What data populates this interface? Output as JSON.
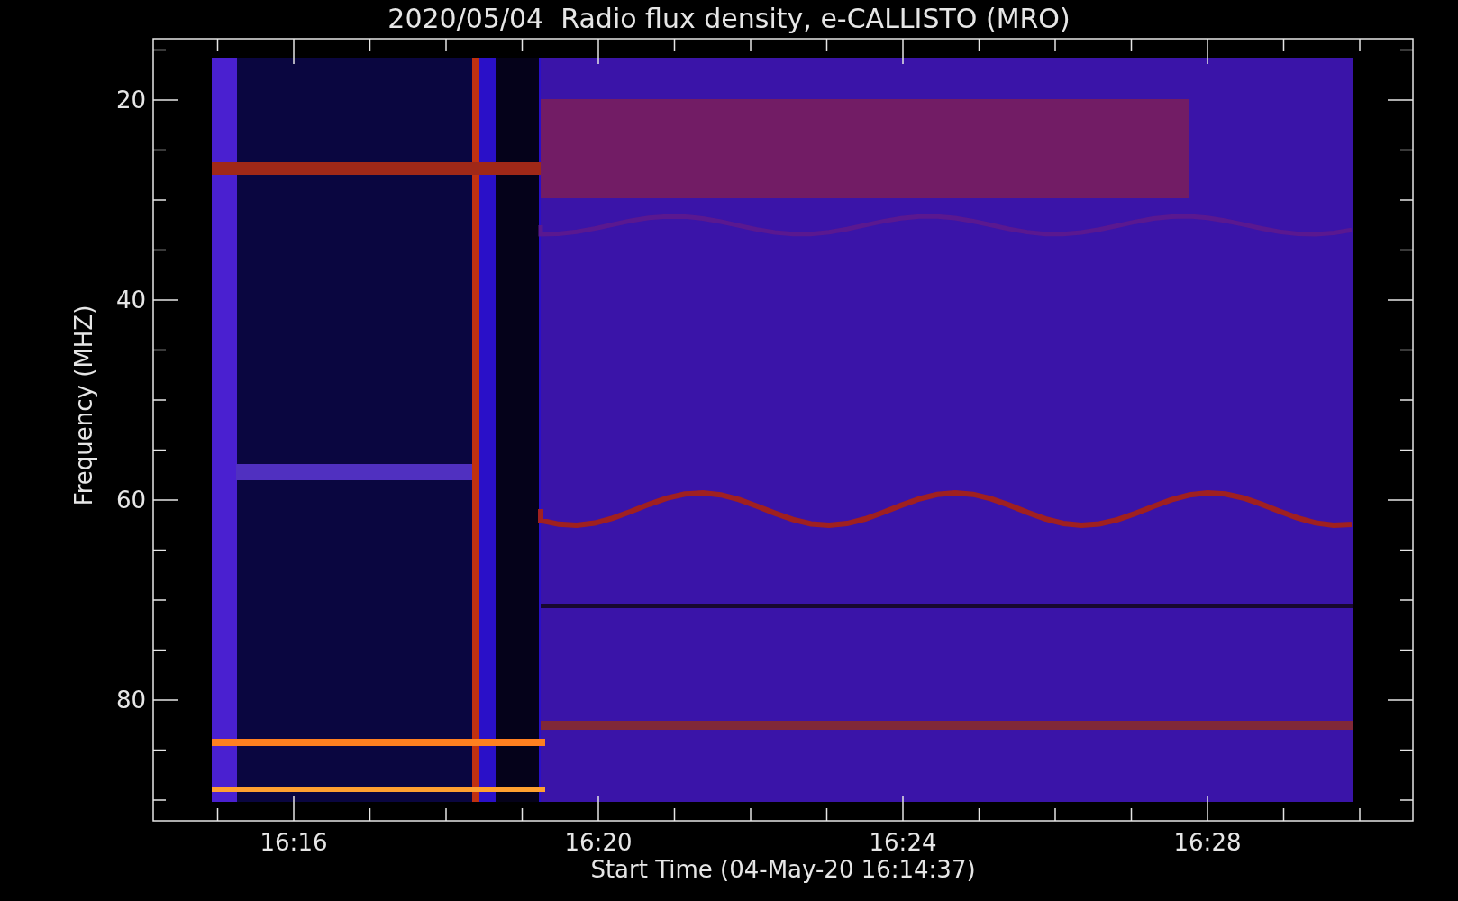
{
  "title": "2020/05/04  Radio flux density, e-CALLISTO (MRO)",
  "y_axis": {
    "label": "Frequency (MHZ)",
    "ticks": [
      "20",
      "40",
      "60",
      "80"
    ]
  },
  "x_axis": {
    "label": "Start Time (04-May-20 16:14:37)",
    "ticks": [
      "16:16",
      "16:20",
      "16:24",
      "16:28"
    ]
  }
}
